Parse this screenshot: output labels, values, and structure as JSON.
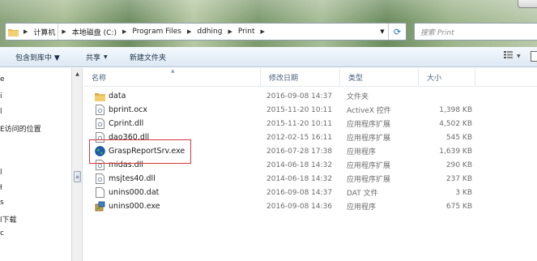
{
  "address_bar": {
    "breadcrumbs": [
      {
        "label": "计算机"
      },
      {
        "label": "本地磁盘 (C:)"
      },
      {
        "label": "Program Files"
      },
      {
        "label": "ddhing"
      },
      {
        "label": "Print"
      }
    ]
  },
  "search": {
    "placeholder": "搜索 Print"
  },
  "toolbar": {
    "include_library_label": "包含到库中 ▼",
    "share_label": "共享",
    "new_folder_label": "新建文件夹"
  },
  "nav_pane": {
    "items": [
      {
        "label": "e"
      },
      {
        "label": "i"
      },
      {
        "label": "l"
      },
      {
        "label": "E访问的位置"
      },
      {
        "label": "l"
      },
      {
        "label": "ł"
      },
      {
        "label": "s"
      },
      {
        "label": "l下载"
      },
      {
        "label": "c"
      }
    ]
  },
  "file_list": {
    "columns": {
      "name": "名称",
      "date": "修改日期",
      "type": "类型",
      "size": "大小"
    },
    "rows": [
      {
        "name": "data",
        "date": "2016-09-08 14:37",
        "type": "文件夹",
        "size": "",
        "icon": "folder-icon"
      },
      {
        "name": "bprint.ocx",
        "date": "2015-11-20 10:11",
        "type": "ActiveX 控件",
        "size": "1,398 KB",
        "icon": "activex-file-icon"
      },
      {
        "name": "Cprint.dll",
        "date": "2015-11-20 10:11",
        "type": "应用程序扩展",
        "size": "4,502 KB",
        "icon": "dll-file-icon"
      },
      {
        "name": "dao360.dll",
        "date": "2012-02-15 16:11",
        "type": "应用程序扩展",
        "size": "545 KB",
        "icon": "dll-file-icon"
      },
      {
        "name": "GraspReportSrv.exe",
        "date": "2016-07-28 17:38",
        "type": "应用程序",
        "size": "1,639 KB",
        "icon": "globe-exe-icon"
      },
      {
        "name": "midas.dll",
        "date": "2014-06-18 14:32",
        "type": "应用程序扩展",
        "size": "290 KB",
        "icon": "dll-file-icon"
      },
      {
        "name": "msjtes40.dll",
        "date": "2014-06-18 14:32",
        "type": "应用程序扩展",
        "size": "237 KB",
        "icon": "dll-file-icon"
      },
      {
        "name": "unins000.dat",
        "date": "2016-09-08 14:37",
        "type": "DAT 文件",
        "size": "3 KB",
        "icon": "blank-file-icon"
      },
      {
        "name": "unins000.exe",
        "date": "2016-09-08 14:36",
        "type": "应用程序",
        "size": "675 KB",
        "icon": "installer-exe-icon"
      }
    ]
  },
  "colors": {
    "highlight_box": "#d9363e",
    "folder": "#e8b64a",
    "column_header_text": "#4c607a"
  }
}
